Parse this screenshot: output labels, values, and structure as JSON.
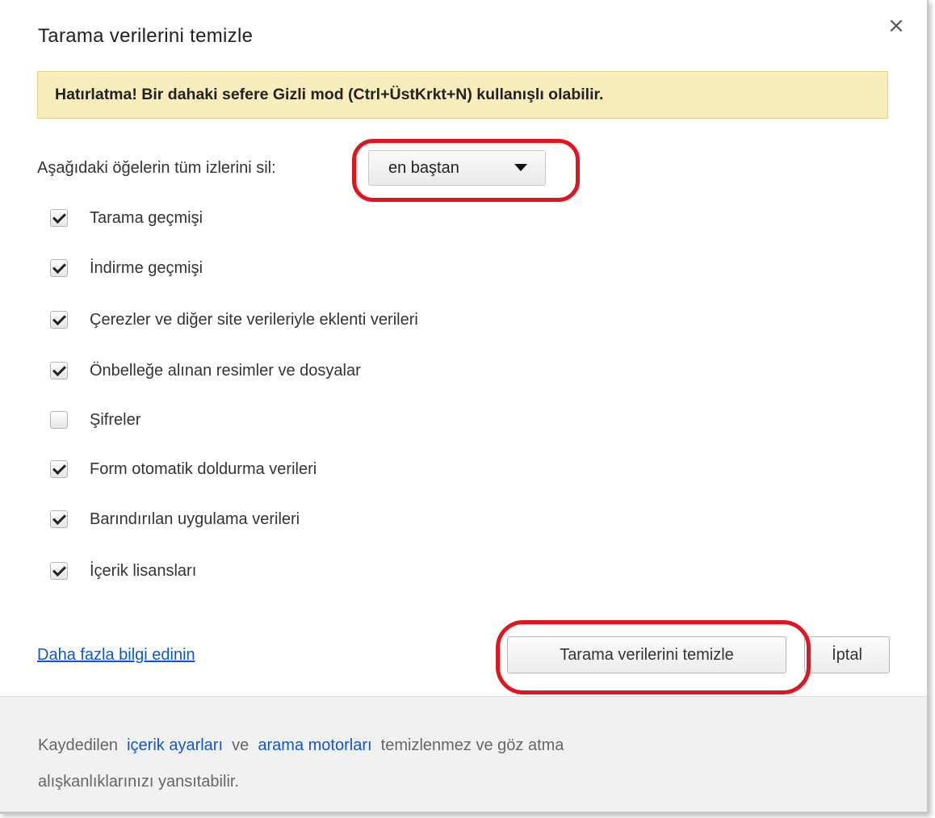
{
  "dialog": {
    "title": "Tarama verilerini temizle",
    "close_symbol": "×"
  },
  "notice": {
    "text": "Hatırlatma! Bir dahaki sefere Gizli mod (Ctrl+ÜstKrkt+N) kullanışlı olabilir."
  },
  "period": {
    "label": "Aşağıdaki öğelerin tüm izlerini sil:",
    "selected": "en baştan"
  },
  "options": [
    {
      "label": "Tarama geçmişi",
      "checked": true
    },
    {
      "label": "İndirme geçmişi",
      "checked": true
    },
    {
      "label": "Çerezler ve diğer site verileriyle eklenti verileri",
      "checked": true
    },
    {
      "label": "Önbelleğe alınan resimler ve dosyalar",
      "checked": true
    },
    {
      "label": "Şifreler",
      "checked": false
    },
    {
      "label": "Form otomatik doldurma verileri",
      "checked": true
    },
    {
      "label": "Barındırılan uygulama verileri",
      "checked": true
    },
    {
      "label": "İçerik lisansları",
      "checked": true
    }
  ],
  "actions": {
    "more_info_link": "Daha fazla bilgi edinin",
    "clear_button": "Tarama verilerini temizle",
    "cancel_button": "İptal"
  },
  "footer": {
    "text_1": "Kaydedilen",
    "link_1": "içerik ayarları",
    "text_2": "ve",
    "link_2": "arama motorları",
    "text_3": "temizlenmez ve göz atma",
    "text_4": "alışkanlıklarınızı yansıtabilir."
  },
  "colors": {
    "notice_bg": "#f9edbe",
    "link": "#1155cc",
    "highlight_ring": "#e01520",
    "footer_bg": "#f1f1f1"
  }
}
